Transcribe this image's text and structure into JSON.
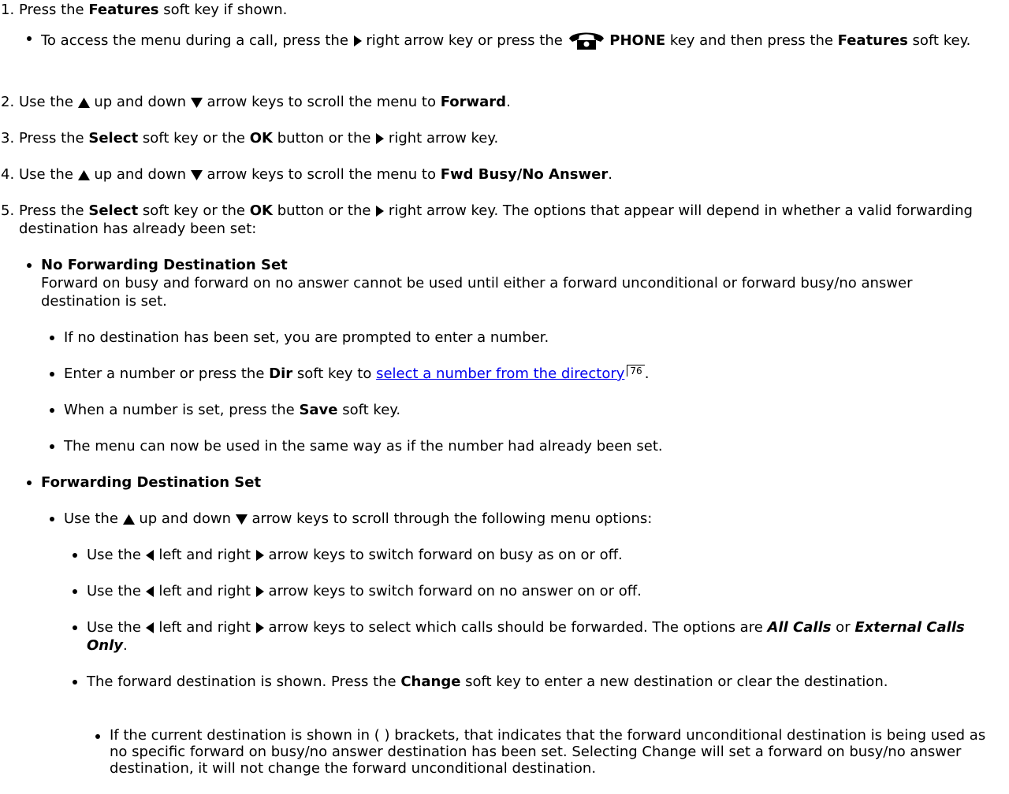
{
  "steps": [
    {
      "num": "1.",
      "p1": "Press the ",
      "b1": "Features",
      "p2": " soft key if shown."
    },
    {
      "num": "2.",
      "p1": "Use the ",
      "p2": " up and down ",
      "p3": " arrow keys to scroll the menu to ",
      "b1": "Forward",
      "p4": "."
    },
    {
      "num": "3.",
      "p1": "Press the ",
      "b1": "Select",
      "p2": " soft key or the ",
      "b2": "OK",
      "p3": " button or the ",
      "p4": " right arrow key."
    },
    {
      "num": "4.",
      "p1": "Use the ",
      "p2": " up and down ",
      "p3": " arrow keys to scroll the menu to ",
      "b1": "Fwd Busy/No Answer",
      "p4": "."
    },
    {
      "num": "5.",
      "p1": "Press the ",
      "b1": "Select",
      "p2": " soft key or the ",
      "b2": "OK",
      "p3": " button or the ",
      "p4": " right arrow key. The options that appear will depend in whether a valid forwarding destination has already been set:"
    }
  ],
  "call_note": {
    "p1": "To access the menu during a call, press the ",
    "p2": " right arrow key or press the ",
    "b1": "PHONE",
    "p3": " key and then press the ",
    "b2": "Features",
    "p4": " soft key."
  },
  "no_dest": {
    "heading": "No Forwarding Destination Set",
    "text": "Forward on busy and forward on no answer cannot be used until either a forward unconditional or forward busy/no answer destination is set.",
    "items": [
      {
        "text": "If no destination has been set, you are prompted to enter a number."
      },
      {
        "p1": "Enter a number or press the ",
        "b1": "Dir",
        "p2": " soft key to ",
        "link": "select a number from the directory",
        "ref": "76",
        "p3": "."
      },
      {
        "p1": "When a number is set, press the ",
        "b1": "Save",
        "p2": " soft key."
      },
      {
        "text": "The menu can now be used in the same way as if the number had already been set."
      }
    ]
  },
  "dest_set": {
    "heading": "Forwarding Destination Set",
    "scroll": {
      "p1": "Use the ",
      "p2": " up and down ",
      "p3": " arrow keys to scroll through the following menu options:"
    },
    "options": [
      {
        "p1": "Use the ",
        "p2": " left and right ",
        "p3": " arrow keys to switch forward on busy as on or off."
      },
      {
        "p1": "Use the ",
        "p2": " left and right ",
        "p3": " arrow keys to switch forward on no answer on or off."
      },
      {
        "p1": "Use the ",
        "p2": " left and right ",
        "p3": " arrow keys to select which calls should be forwarded. The options are ",
        "i1": "All Calls",
        "p4": " or ",
        "i2": "External Calls Only",
        "p5": "."
      },
      {
        "p1": "The forward destination is shown. Press the ",
        "b1": "Change",
        "p2": " soft key to enter a new destination or clear the destination."
      }
    ],
    "bracket_note": "If the current destination is shown in ( ) brackets, that indicates that the forward unconditional destination is being used as no specific forward on busy/no answer destination has been set. Selecting Change will set a forward on busy/no answer destination, it will not change the forward unconditional destination."
  },
  "icons": {
    "right": "right-arrow-icon",
    "left": "left-arrow-icon",
    "up": "up-arrow-icon",
    "down": "down-arrow-icon",
    "phone": "phone-icon"
  },
  "colors": {
    "link": "#0000ee",
    "text": "#000000"
  }
}
